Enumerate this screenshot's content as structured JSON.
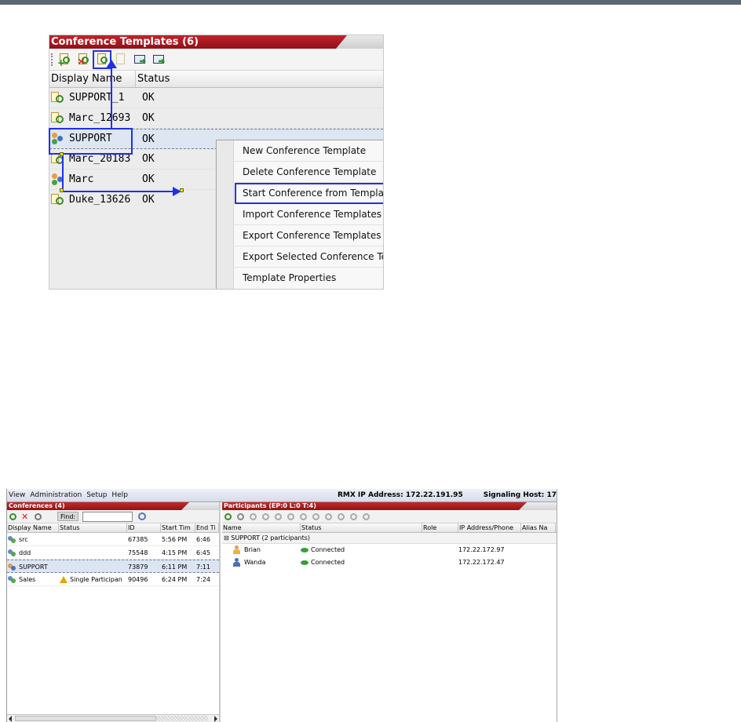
{
  "templates_panel": {
    "title": "Conference Templates (6)",
    "columns": [
      "Display Name",
      "Status"
    ],
    "rows": [
      {
        "name": "SUPPORT_1",
        "status": "OK"
      },
      {
        "name": "Marc_12693",
        "status": "OK"
      },
      {
        "name": "SUPPORT",
        "status": "OK"
      },
      {
        "name": "Marc_20183",
        "status": "OK"
      },
      {
        "name": "Marc",
        "status": "OK"
      },
      {
        "name": "Duke_13626",
        "status": "OK"
      }
    ],
    "toolbar_icons": [
      "new-template-icon",
      "delete-template-icon",
      "start-conference-from-template-icon",
      "template-properties-icon",
      "import-templates-icon",
      "export-templates-icon"
    ],
    "context_menu": [
      "New Conference Template",
      "Delete Conference Template",
      "Start Conference from Template",
      "Import Conference Templates",
      "Export Conference Templates",
      "Export Selected Conference Templates",
      "Template Properties"
    ]
  },
  "app": {
    "menu": [
      "View",
      "Administration",
      "Setup",
      "Help"
    ],
    "rmx_ip": "RMX IP Address: 172.22.191.95",
    "signaling_host": "Signaling Host: 17",
    "conferences": {
      "title": "Conferences (4)",
      "find_label": "Find:",
      "columns": [
        "Display Name",
        "Status",
        "ID",
        "Start Tim",
        "End Ti"
      ],
      "rows": [
        {
          "name": "src",
          "status": "",
          "id": "67385",
          "start": "5:56 PM",
          "end": "6:46"
        },
        {
          "name": "ddd",
          "status": "",
          "id": "75548",
          "start": "4:15 PM",
          "end": "6:45"
        },
        {
          "name": "SUPPORT",
          "status": "",
          "id": "73879",
          "start": "6:11 PM",
          "end": "7:11"
        },
        {
          "name": "Sales",
          "status": "Single Participan",
          "id": "90496",
          "start": "6:24 PM",
          "end": "7:24"
        }
      ]
    },
    "participants": {
      "title": "Participants (EP:0 L:0 T:4)",
      "columns": [
        "Name",
        "Status",
        "Role",
        "IP Address/Phone",
        "Alias Na"
      ],
      "group": "SUPPORT (2  participants)",
      "rows": [
        {
          "name": "Brian",
          "status": "Connected",
          "ip": "172.22.172.97"
        },
        {
          "name": "Wanda",
          "status": "Connected",
          "ip": "172.22.172.47"
        }
      ]
    }
  },
  "colors": {
    "header_red": "#a8181f",
    "annotation_blue": "#1f2ff0",
    "selection": "#dde6f1"
  }
}
